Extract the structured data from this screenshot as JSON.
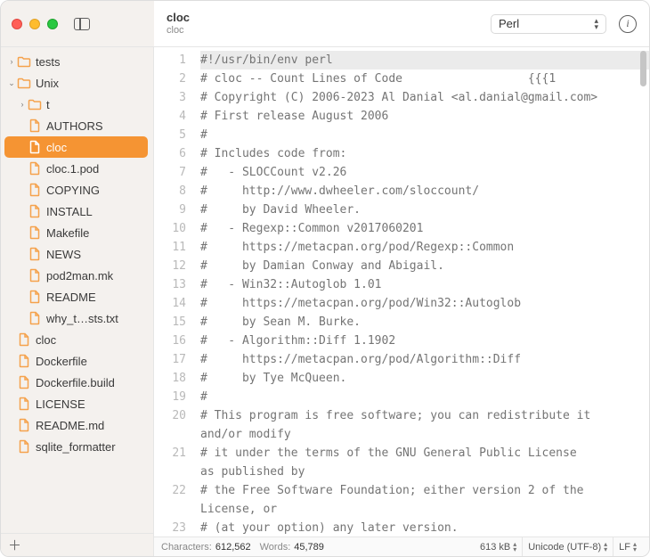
{
  "header": {
    "title": "cloc",
    "subtitle": "cloc",
    "language": "Perl"
  },
  "sidebar": {
    "items": [
      {
        "depth": 0,
        "kind": "folder",
        "expander": "›",
        "label": "tests",
        "selected": false
      },
      {
        "depth": 0,
        "kind": "folder",
        "expander": "⌄",
        "label": "Unix",
        "selected": false
      },
      {
        "depth": 1,
        "kind": "folder",
        "expander": "›",
        "label": "t",
        "selected": false
      },
      {
        "depth": 1,
        "kind": "file",
        "expander": "",
        "label": "AUTHORS",
        "selected": false
      },
      {
        "depth": 1,
        "kind": "file",
        "expander": "",
        "label": "cloc",
        "selected": true
      },
      {
        "depth": 1,
        "kind": "file",
        "expander": "",
        "label": "cloc.1.pod",
        "selected": false
      },
      {
        "depth": 1,
        "kind": "file",
        "expander": "",
        "label": "COPYING",
        "selected": false
      },
      {
        "depth": 1,
        "kind": "file",
        "expander": "",
        "label": "INSTALL",
        "selected": false
      },
      {
        "depth": 1,
        "kind": "file",
        "expander": "",
        "label": "Makefile",
        "selected": false
      },
      {
        "depth": 1,
        "kind": "file",
        "expander": "",
        "label": "NEWS",
        "selected": false
      },
      {
        "depth": 1,
        "kind": "file",
        "expander": "",
        "label": "pod2man.mk",
        "selected": false
      },
      {
        "depth": 1,
        "kind": "file",
        "expander": "",
        "label": "README",
        "selected": false
      },
      {
        "depth": 1,
        "kind": "file",
        "expander": "",
        "label": "why_t…sts.txt",
        "selected": false
      },
      {
        "depth": 0,
        "kind": "file",
        "expander": "",
        "label": "cloc",
        "selected": false
      },
      {
        "depth": 0,
        "kind": "file",
        "expander": "",
        "label": "Dockerfile",
        "selected": false
      },
      {
        "depth": 0,
        "kind": "file",
        "expander": "",
        "label": "Dockerfile.build",
        "selected": false
      },
      {
        "depth": 0,
        "kind": "file",
        "expander": "",
        "label": "LICENSE",
        "selected": false
      },
      {
        "depth": 0,
        "kind": "file",
        "expander": "",
        "label": "README.md",
        "selected": false
      },
      {
        "depth": 0,
        "kind": "file",
        "expander": "",
        "label": "sqlite_formatter",
        "selected": false
      }
    ]
  },
  "editor": {
    "lines": [
      {
        "n": 1,
        "text": "#!/usr/bin/env perl",
        "hl": true
      },
      {
        "n": 2,
        "text": "# cloc -- Count Lines of Code                  {{{1"
      },
      {
        "n": 3,
        "text": "# Copyright (C) 2006-2023 Al Danial <al.danial@gmail.com>"
      },
      {
        "n": 4,
        "text": "# First release August 2006"
      },
      {
        "n": 5,
        "text": "#"
      },
      {
        "n": 6,
        "text": "# Includes code from:"
      },
      {
        "n": 7,
        "text": "#   - SLOCCount v2.26"
      },
      {
        "n": 8,
        "text": "#     http://www.dwheeler.com/sloccount/"
      },
      {
        "n": 9,
        "text": "#     by David Wheeler."
      },
      {
        "n": 10,
        "text": "#   - Regexp::Common v2017060201"
      },
      {
        "n": 11,
        "text": "#     https://metacpan.org/pod/Regexp::Common"
      },
      {
        "n": 12,
        "text": "#     by Damian Conway and Abigail."
      },
      {
        "n": 13,
        "text": "#   - Win32::Autoglob 1.01"
      },
      {
        "n": 14,
        "text": "#     https://metacpan.org/pod/Win32::Autoglob"
      },
      {
        "n": 15,
        "text": "#     by Sean M. Burke."
      },
      {
        "n": 16,
        "text": "#   - Algorithm::Diff 1.1902"
      },
      {
        "n": 17,
        "text": "#     https://metacpan.org/pod/Algorithm::Diff"
      },
      {
        "n": 18,
        "text": "#     by Tye McQueen."
      },
      {
        "n": 19,
        "text": "#"
      },
      {
        "n": 20,
        "text": "# This program is free software; you can redistribute it"
      },
      {
        "n": 20,
        "text": "and/or modify",
        "wrap": true
      },
      {
        "n": 21,
        "text": "# it under the terms of the GNU General Public License"
      },
      {
        "n": 21,
        "text": "as published by",
        "wrap": true
      },
      {
        "n": 22,
        "text": "# the Free Software Foundation; either version 2 of the"
      },
      {
        "n": 22,
        "text": "License, or",
        "wrap": true
      },
      {
        "n": 23,
        "text": "# (at your option) any later version."
      }
    ]
  },
  "status": {
    "characters_label": "Characters:",
    "characters": "612,562",
    "words_label": "Words:",
    "words": "45,789",
    "filesize": "613 kB",
    "encoding": "Unicode (UTF-8)",
    "line_ending": "LF"
  }
}
